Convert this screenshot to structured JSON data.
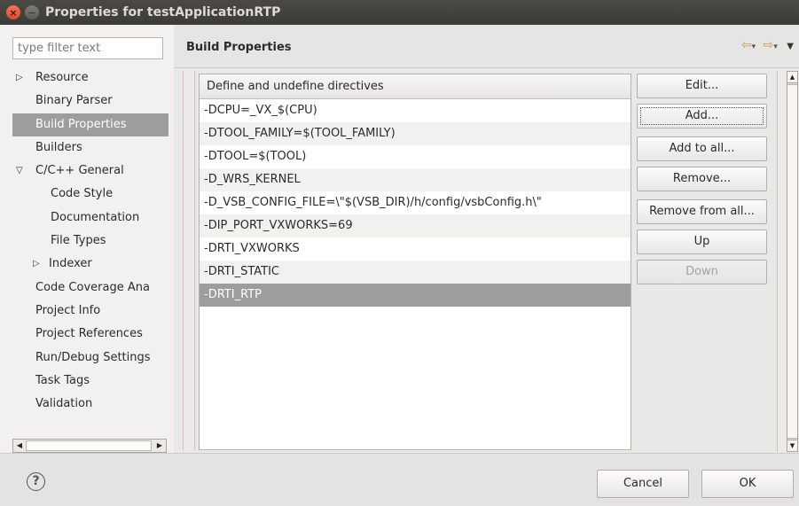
{
  "window": {
    "title": "Properties for testApplicationRTP",
    "close_glyph": "×",
    "minimize_glyph": "−"
  },
  "sidebar": {
    "filter_placeholder": "type filter text",
    "items": [
      {
        "label": "Resource",
        "indent": 0,
        "twisty": "▷"
      },
      {
        "label": "Binary Parser",
        "indent": 1
      },
      {
        "label": "Build Properties",
        "indent": 1,
        "selected": true
      },
      {
        "label": "Builders",
        "indent": 1
      },
      {
        "label": "C/C++ General",
        "indent": 0,
        "twisty": "▽"
      },
      {
        "label": "Code Style",
        "indent": 2
      },
      {
        "label": "Documentation",
        "indent": 2
      },
      {
        "label": "File Types",
        "indent": 2
      },
      {
        "label": "Indexer",
        "indent": 1,
        "twisty": "▷"
      },
      {
        "label": "Code Coverage Ana",
        "indent": 1
      },
      {
        "label": "Project Info",
        "indent": 1
      },
      {
        "label": "Project References",
        "indent": 1
      },
      {
        "label": "Run/Debug Settings",
        "indent": 1
      },
      {
        "label": "Task Tags",
        "indent": 1
      },
      {
        "label": "Validation",
        "indent": 1
      }
    ]
  },
  "header": {
    "title": "Build Properties",
    "back_glyph": "⇦",
    "forward_glyph": "⇨",
    "dropdown_glyph": "▾",
    "menu_glyph": "▼"
  },
  "table": {
    "column_header": "Define and undefine directives",
    "rows": [
      "-DCPU=_VX_$(CPU)",
      "-DTOOL_FAMILY=$(TOOL_FAMILY)",
      "-DTOOL=$(TOOL)",
      "-D_WRS_KERNEL",
      "-D_VSB_CONFIG_FILE=\\\"$(VSB_DIR)/h/config/vsbConfig.h\\\"",
      "-DIP_PORT_VXWORKS=69",
      "-DRTI_VXWORKS",
      "-DRTI_STATIC",
      "-DRTI_RTP"
    ],
    "selected_index": 8
  },
  "buttons": {
    "edit": "Edit...",
    "add": "Add...",
    "add_to_all": "Add to all...",
    "remove": "Remove...",
    "remove_from_all": "Remove from all...",
    "up": "Up",
    "down": "Down"
  },
  "scroll_glyphs": {
    "left": "◀",
    "right": "▶",
    "up": "▲",
    "down": "▼"
  },
  "footer": {
    "help_glyph": "?",
    "cancel": "Cancel",
    "ok": "OK"
  }
}
